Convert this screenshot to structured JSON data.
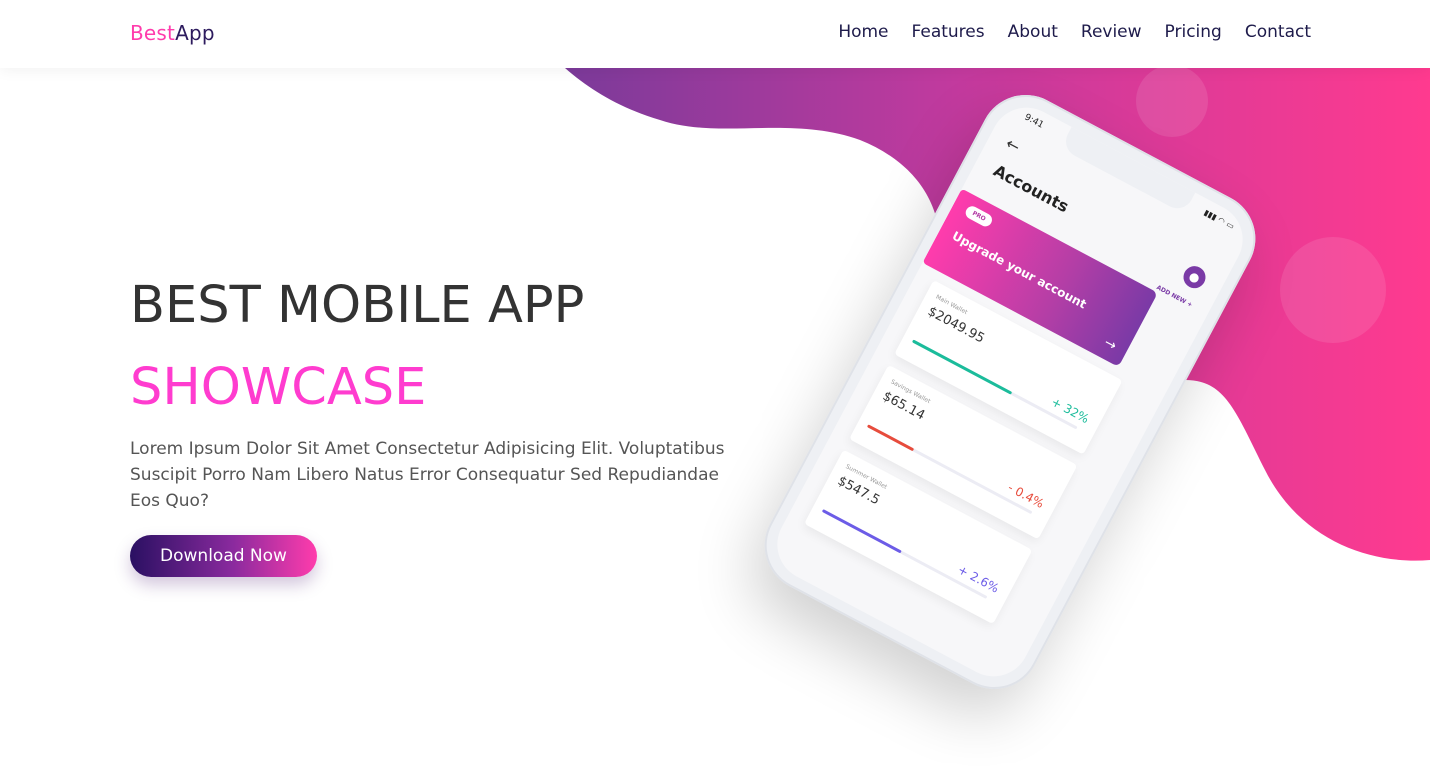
{
  "brand": {
    "logo_part1": "Best",
    "logo_part2": "App",
    "color_primary": "#ff3cac",
    "color_dark": "#2d1b5e"
  },
  "nav": {
    "items": [
      "Home",
      "Features",
      "About",
      "Review",
      "Pricing",
      "Contact"
    ]
  },
  "hero": {
    "title_line1": "BEST MOBILE APP",
    "title_line2": "SHOWCASE",
    "description": "Lorem Ipsum Dolor Sit Amet Consectetur Adipisicing Elit. Voluptatibus Suscipit Porro Nam Libero Natus Error Consequatur Sed Repudiandae Eos Quo?",
    "button_label": "Download Now",
    "accent_color": "#ff3ccf"
  },
  "phone": {
    "time": "9:41",
    "screen_title": "Accounts",
    "add_new_label": "ADD NEW",
    "back_icon": "arrow-left-icon",
    "profile_icon": "user-icon",
    "upgrade_card": {
      "badge": "PRO",
      "text": "Upgrade your account"
    },
    "wallets": [
      {
        "label": "Main Wallet",
        "amount": "$2049.95",
        "change": "+ 32%",
        "color": "#1bbc9b",
        "progress": 0.6
      },
      {
        "label": "Savings Wallet",
        "amount": "$65.14",
        "change": "- 0.4%",
        "color": "#e74c3c",
        "progress": 0.28
      },
      {
        "label": "Summer Wallet",
        "amount": "$547.5",
        "change": "+ 2.6%",
        "color": "#6c5ce7",
        "progress": 0.48
      }
    ]
  }
}
